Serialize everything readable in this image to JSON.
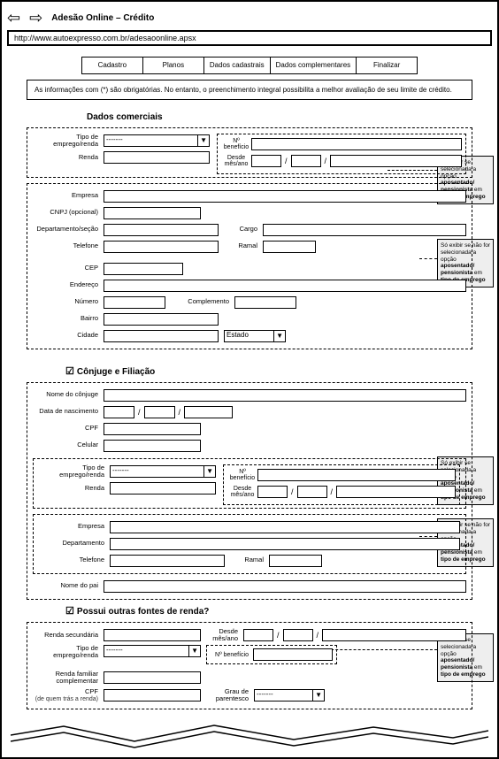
{
  "browser": {
    "title": "Adesão Online – Crédito",
    "url": "http://www.autoexpresso.com.br/adesaoonline.apsx"
  },
  "tabs": [
    "Cadastro",
    "Planos",
    "Dados cadastrais",
    "Dados complementares",
    "Finalizar"
  ],
  "info_text": "As informações com (*) são obrigatórias. No entanto, o preenchimento integral possibilita a melhor avaliação de seu limite de crédito.",
  "sections": {
    "comerciais": {
      "title": "Dados comerciais",
      "labels": {
        "tipo": "Tipo de emprego/renda",
        "renda": "Renda",
        "beneficio": "Nº benefício",
        "desde": "Desde mês/ano",
        "empresa": "Empresa",
        "cnpj": "CNPJ (opcional)",
        "depto": "Departamento/seção",
        "cargo": "Cargo",
        "telefone": "Telefone",
        "ramal": "Ramal",
        "cep": "CEP",
        "endereco": "Endereço",
        "numero": "Número",
        "complemento": "Complemento",
        "bairro": "Bairro",
        "cidade": "Cidade",
        "estado": "Estado"
      },
      "select_placeholder": "-------"
    },
    "conjuge": {
      "title": "Cônjuge e Filiação",
      "labels": {
        "nome": "Nome do cônjuge",
        "nascimento": "Data de nascimento",
        "cpf": "CPF",
        "celular": "Celular",
        "tipo": "Tipo de emprego/renda",
        "renda": "Renda",
        "beneficio": "Nº benefício",
        "desde": "Desde mês/ano",
        "empresa": "Empresa",
        "depto": "Departamento",
        "telefone": "Telefone",
        "ramal": "Ramal",
        "pai": "Nome do pai"
      },
      "select_placeholder": "-------"
    },
    "outras": {
      "title": "Possui outras fontes de renda?",
      "labels": {
        "secundaria": "Renda secundária",
        "desde": "Desde mês/ano",
        "tipo": "Tipo de emprego/renda",
        "beneficio": "Nº benefício",
        "familiar": "Renda familiar complementar",
        "cpf": "CPF",
        "cpf_sub": "(de quem trás a renda)",
        "grau": "Grau de parentesco"
      },
      "select_placeholder": "-------"
    }
  },
  "annotations": {
    "show_if_selected": "Só exibir se selecionada a opção aposentado/ pensionista em tipo de emprego",
    "show_if_not_selected": "Só exibir se não for selecionada a opção aposentado/ pensionista em tipo de emprego"
  }
}
